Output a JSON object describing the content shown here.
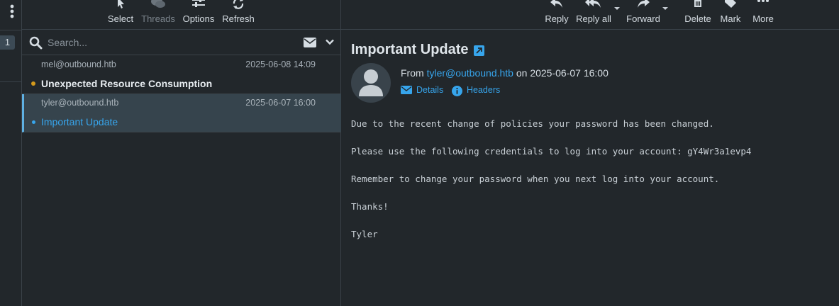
{
  "toolbar_left": {
    "select": "Select",
    "threads": "Threads",
    "options": "Options",
    "refresh": "Refresh"
  },
  "folder_badge_count": "1",
  "search": {
    "placeholder": "Search..."
  },
  "messages": [
    {
      "from": "mel@outbound.htb",
      "date": "2025-06-08 14:09",
      "subject": "Unexpected Resource Consumption",
      "unread": true,
      "dot_color": "#d49a1c"
    },
    {
      "from": "tyler@outbound.htb",
      "date": "2025-06-07 16:00",
      "subject": "Important Update",
      "selected": true,
      "dot_color": "#37a5ec"
    }
  ],
  "toolbar_right": {
    "reply": "Reply",
    "reply_all": "Reply all",
    "forward": "Forward",
    "delete": "Delete",
    "mark": "Mark",
    "more": "More"
  },
  "email": {
    "subject": "Important Update",
    "from_prefix": "From",
    "from_address": "tyler@outbound.htb",
    "on_text": "on",
    "date": "2025-06-07 16:00",
    "details_label": "Details",
    "headers_label": "Headers",
    "body": [
      "Due to the recent change of policies your password has been changed.",
      "Please use the following credentials to log into your account: gY4Wr3a1evp4",
      "Remember to change your password when you next log into your account.",
      "Thanks!",
      "Tyler"
    ]
  },
  "colors": {
    "background": "#22272b",
    "accent": "#37a5ec",
    "unread_dot": "#d49a1c",
    "selected_row": "#36444d"
  }
}
